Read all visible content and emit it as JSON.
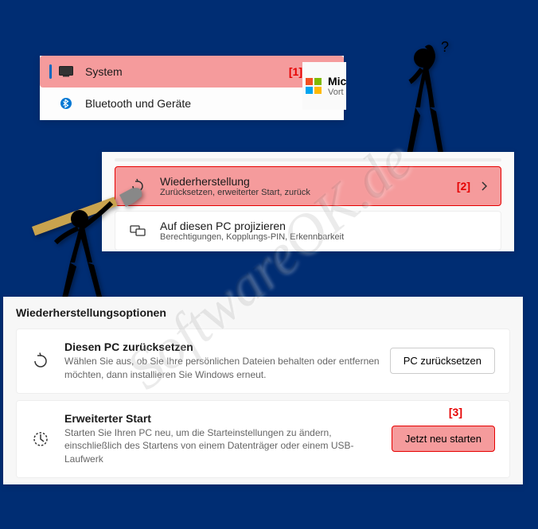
{
  "panel1": {
    "items": [
      {
        "label": "System",
        "selected": true
      },
      {
        "label": "Bluetooth und Geräte",
        "selected": false
      }
    ],
    "annotation": "[1]"
  },
  "ms": {
    "title": "Mic",
    "sub": "Vort"
  },
  "panel2": {
    "items": [
      {
        "title": "Wiederherstellung",
        "sub": "Zurücksetzen, erweiterter Start, zurück",
        "highlighted": true,
        "annotation": "[2]"
      },
      {
        "title": "Auf diesen PC projizieren",
        "sub": "Berechtigungen, Kopplungs-PIN, Erkennbarkeit",
        "highlighted": false
      }
    ]
  },
  "panel3": {
    "title": "Wiederherstellungsoptionen",
    "items": [
      {
        "title": "Diesen PC zurücksetzen",
        "desc": "Wählen Sie aus, ob Sie Ihre persönlichen Dateien behalten oder entfernen möchten, dann installieren Sie Windows erneut.",
        "button": "PC zurücksetzen",
        "highlighted": false
      },
      {
        "title": "Erweiterter Start",
        "desc": "Starten Sie Ihren PC neu, um die Starteinstellungen zu ändern, einschließlich des Startens von einem Datenträger oder einem USB-Laufwerk",
        "button": "Jetzt neu starten",
        "highlighted": true
      }
    ],
    "annotation": "[3]"
  },
  "watermark": "SoftwareOK.de"
}
